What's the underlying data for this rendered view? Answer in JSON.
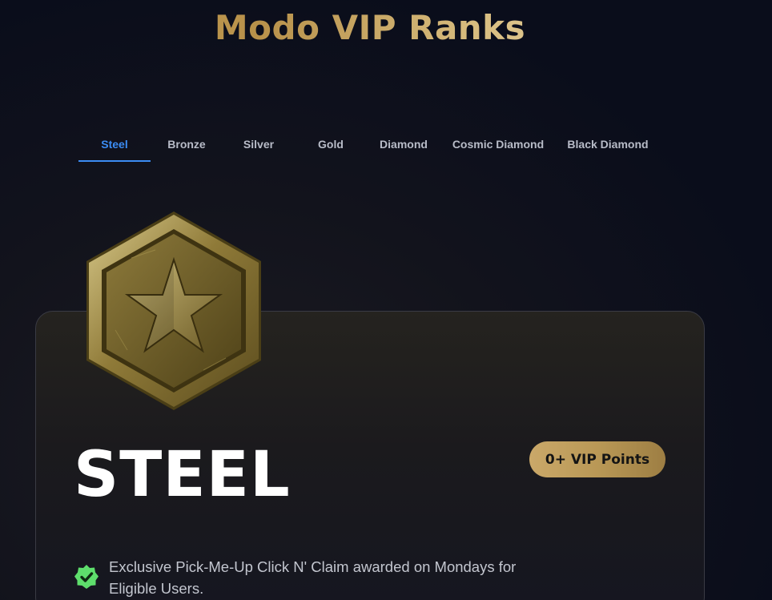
{
  "header": {
    "title": "Modo VIP Ranks"
  },
  "tabs": [
    {
      "label": "Steel",
      "active": true
    },
    {
      "label": "Bronze",
      "active": false
    },
    {
      "label": "Silver",
      "active": false
    },
    {
      "label": "Gold",
      "active": false
    },
    {
      "label": "Diamond",
      "active": false
    },
    {
      "label": "Cosmic Diamond",
      "active": false
    },
    {
      "label": "Black Diamond",
      "active": false
    }
  ],
  "rank_card": {
    "badge_icon": "star-hexagon-badge-icon",
    "name": "STEEL",
    "points_label": "0+ VIP Points",
    "benefits": [
      {
        "icon": "check-badge-icon",
        "text": "Exclusive Pick-Me-Up Click N' Claim awarded on Mondays for Eligible Users."
      }
    ]
  },
  "colors": {
    "background": "#0b0e1c",
    "accent": "#3b8cf3",
    "gold": "#c9a65a",
    "check_green": "#5ede6c"
  }
}
